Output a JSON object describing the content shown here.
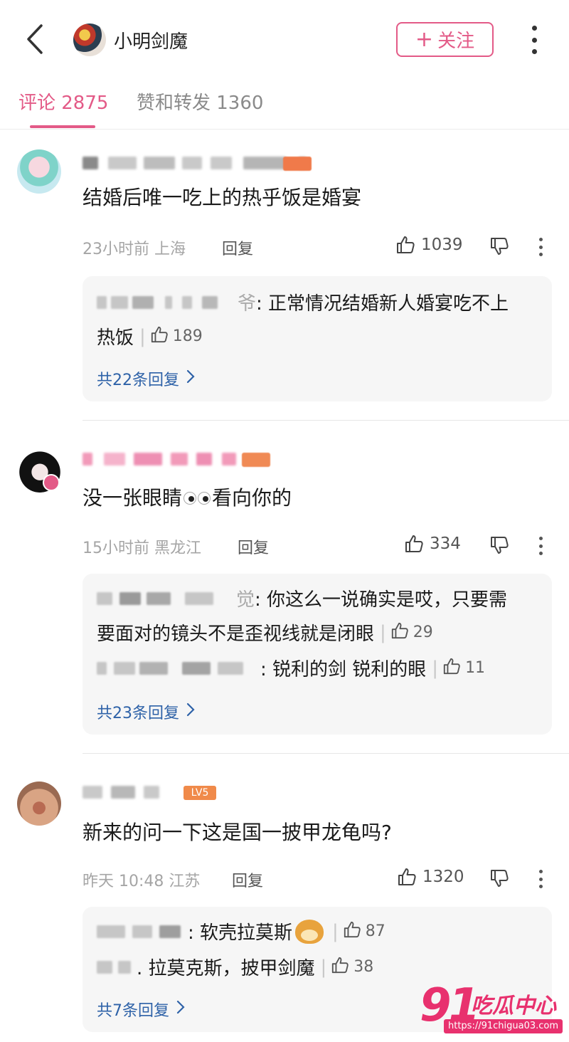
{
  "header": {
    "title": "小明剑魔",
    "follow_label": "关注",
    "follow_plus": "+"
  },
  "tabs": [
    {
      "label": "评论 2875"
    },
    {
      "label": "赞和转发 1360"
    }
  ],
  "comments": [
    {
      "text": "结婚后唯一吃上的热乎饭是婚宴",
      "time_location": "23小时前 上海",
      "reply_label": "回复",
      "likes": "1039",
      "replies": [
        {
          "name_tail": "爷",
          "text_line1": ": 正常情况结婚新人婚宴吃不上",
          "text_line2": "热饭",
          "likes": "189"
        }
      ],
      "more_label": "共22条回复"
    },
    {
      "text_before": "没一张眼睛",
      "text_after": "看向你的",
      "time_location": "15小时前 黑龙江",
      "reply_label": "回复",
      "likes": "334",
      "replies": [
        {
          "name_tail": "觉",
          "text_line1": ": 你这么一说确实是哎，只要需",
          "text_line2": "要面对的镜头不是歪视线就是闭眼",
          "likes": "29"
        },
        {
          "name_tail": "",
          "text": ": 锐利的剑 锐利的眼",
          "likes": "11"
        }
      ],
      "more_label": "共23条回复"
    },
    {
      "text": "新来的问一下这是国一披甲龙龟吗?",
      "level_badge": "LV5",
      "time_location": "昨天 10:48 江苏",
      "reply_label": "回复",
      "likes": "1320",
      "replies": [
        {
          "text": ": 软壳拉莫斯",
          "likes": "87"
        },
        {
          "text": ". 拉莫克斯，披甲剑魔",
          "likes": "38"
        }
      ],
      "more_label": "共7条回复"
    }
  ],
  "watermark": {
    "number": "91",
    "text": "吃瓜中心",
    "url": "https://91chigua03.com"
  },
  "colors": {
    "accent": "#e35a87",
    "link": "#2e62a8",
    "watermark": "#e8316e"
  },
  "icons": [
    "back-arrow-icon",
    "more-vertical-icon",
    "thumbs-up-icon",
    "thumbs-down-icon",
    "chevron-right-icon",
    "doge-emoji-icon",
    "eyes-emoji-icon"
  ]
}
